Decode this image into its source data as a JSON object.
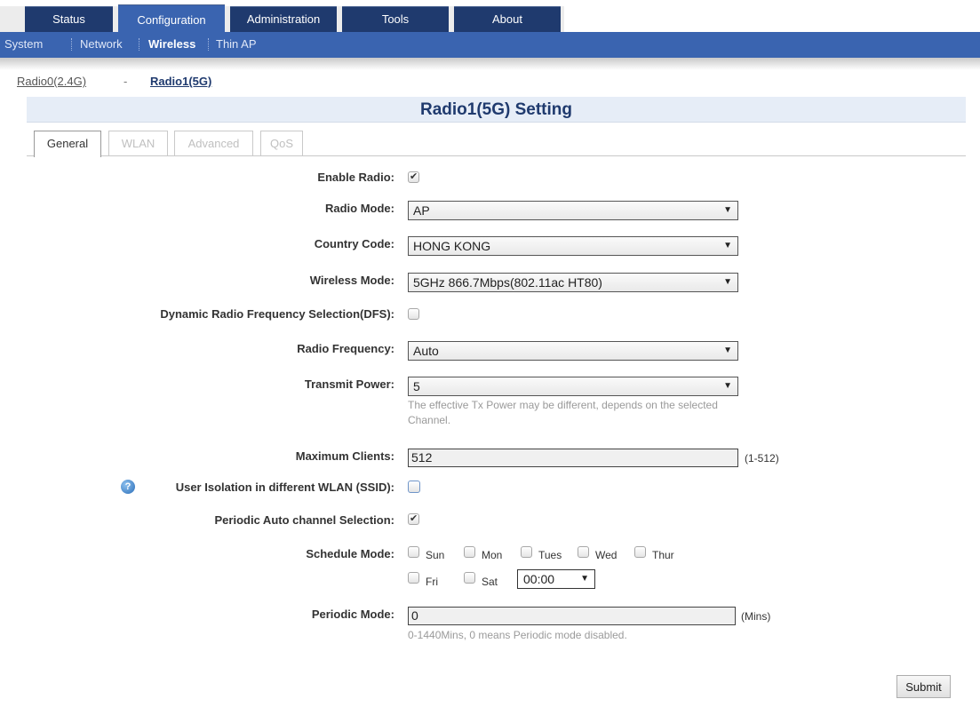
{
  "top_tabs": [
    "Status",
    "Configuration",
    "Administration",
    "Tools",
    "About"
  ],
  "sub_nav": [
    "System",
    "Network",
    "Wireless",
    "Thin AP"
  ],
  "radio_links": {
    "radio0": "Radio0(2.4G)",
    "separator": "-",
    "radio1": "Radio1(5G)"
  },
  "page_title": "Radio1(5G) Setting",
  "setting_tabs": [
    "General",
    "WLAN",
    "Advanced",
    "QoS"
  ],
  "form": {
    "enable_radio": {
      "label": "Enable Radio:",
      "checked": true
    },
    "radio_mode": {
      "label": "Radio Mode:",
      "value": "AP"
    },
    "country_code": {
      "label": "Country Code:",
      "value": "HONG KONG"
    },
    "wireless_mode": {
      "label": "Wireless Mode:",
      "value": "5GHz 866.7Mbps(802.11ac HT80)"
    },
    "dfs": {
      "label": "Dynamic Radio Frequency Selection(DFS):",
      "checked": false
    },
    "radio_frequency": {
      "label": "Radio Frequency:",
      "value": "Auto"
    },
    "transmit_power": {
      "label": "Transmit Power:",
      "value": "5",
      "hint_line1": "The effective Tx Power may be different, depends on the selected",
      "hint_line2": "Channel."
    },
    "max_clients": {
      "label": "Maximum Clients:",
      "value": "512",
      "range": "(1-512)"
    },
    "user_isolation": {
      "label": "User Isolation in different WLAN (SSID):",
      "checked": false
    },
    "periodic_auto_channel": {
      "label": "Periodic Auto channel Selection:",
      "checked": true
    },
    "schedule_mode": {
      "label": "Schedule Mode:",
      "days": [
        "Sun",
        "Mon",
        "Tues",
        "Wed",
        "Thur",
        "Fri",
        "Sat"
      ],
      "time": "00:00"
    },
    "periodic_mode": {
      "label": "Periodic Mode:",
      "value": "0",
      "unit": "(Mins)",
      "hint": "0-1440Mins, 0 means Periodic mode disabled."
    }
  },
  "submit_label": "Submit",
  "icons": {
    "help": "?",
    "dropdown": "▼"
  },
  "colors": {
    "nav_dark": "#1f3a6e",
    "nav_blue": "#3a64b0",
    "title_text": "#1f3a6e",
    "title_band": "#e6edf7"
  }
}
